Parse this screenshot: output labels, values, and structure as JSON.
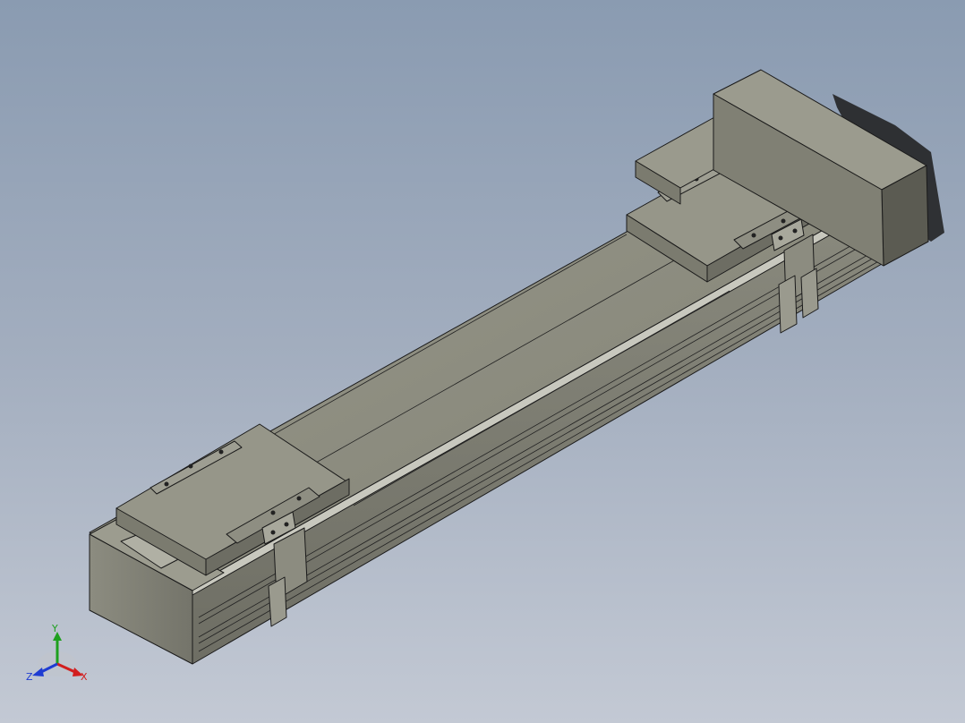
{
  "viewport": {
    "background_top": "#8a9bb1",
    "background_bottom": "#c3c9d4",
    "model_face_top": "#8f8f82",
    "model_face_side": "#7a7a6c",
    "model_face_dark": "#5e5e54"
  },
  "triad": {
    "x_label": "X",
    "y_label": "Y",
    "z_label": "Z",
    "x_color": "#d21e1e",
    "y_color": "#1ea01e",
    "z_color": "#1e3cd2"
  }
}
